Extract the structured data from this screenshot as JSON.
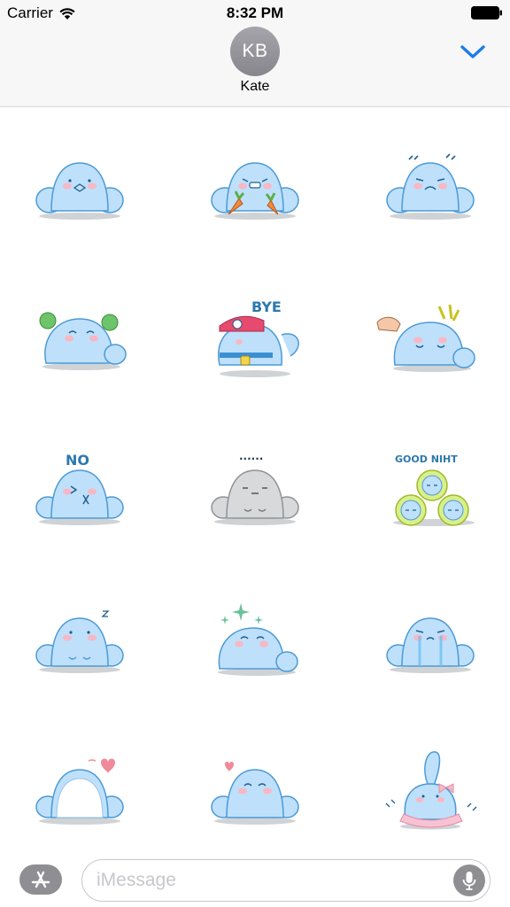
{
  "status_bar": {
    "carrier": "Carrier",
    "time": "8:32 PM",
    "icons": [
      "wifi-icon",
      "battery-icon"
    ]
  },
  "conversation": {
    "contact_initials": "KB",
    "contact_name": "Kate",
    "collapse_icon": "chevron-down-icon"
  },
  "stickers": [
    {
      "id": "neutral",
      "caption": ""
    },
    {
      "id": "carrots",
      "caption": ""
    },
    {
      "id": "annoyed",
      "caption": ""
    },
    {
      "id": "cheer",
      "caption": ""
    },
    {
      "id": "bye",
      "caption": "BYE"
    },
    {
      "id": "pat",
      "caption": ""
    },
    {
      "id": "no",
      "caption": "NO"
    },
    {
      "id": "gray-silent",
      "caption": "......"
    },
    {
      "id": "good-night",
      "caption": "GOOD NIHT"
    },
    {
      "id": "sleepy",
      "caption": ""
    },
    {
      "id": "sparkle",
      "caption": ""
    },
    {
      "id": "crying",
      "caption": ""
    },
    {
      "id": "hug",
      "caption": ""
    },
    {
      "id": "love",
      "caption": ""
    },
    {
      "id": "dance",
      "caption": ""
    }
  ],
  "compose": {
    "placeholder": "iMessage",
    "app_button_icon": "app-store-icon",
    "mic_icon": "microphone-icon"
  },
  "colors": {
    "accent": "#1a7ee6",
    "creature_body": "#bfe0fb",
    "creature_outline": "#4b9ad6",
    "cheek": "#f7b8c4",
    "gray_body": "#d7d9db"
  }
}
